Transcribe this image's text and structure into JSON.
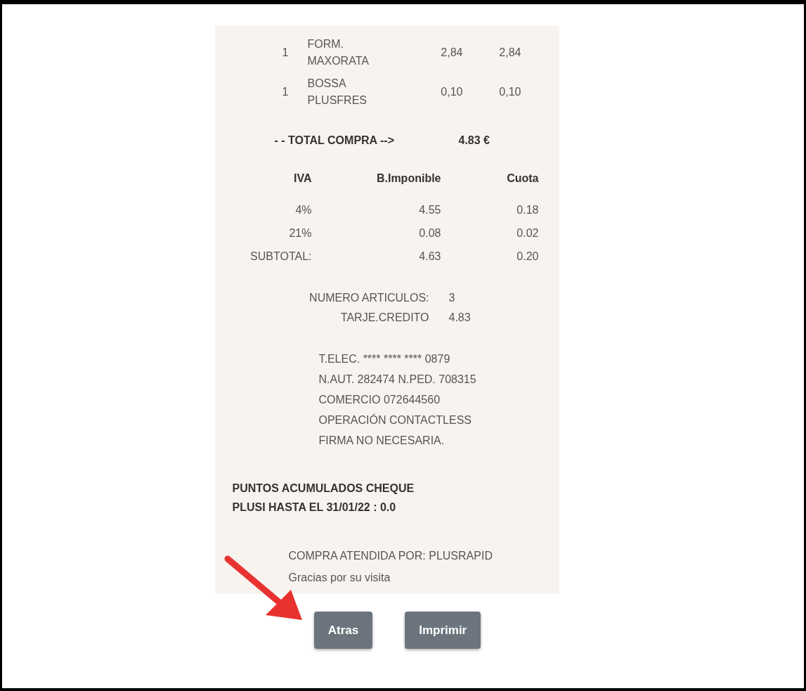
{
  "items": [
    {
      "qty": "1",
      "description": "FORM. MAXORATA",
      "price": "2,84",
      "amount": "2,84"
    },
    {
      "qty": "1",
      "description": "BOSSA PLUSFRES",
      "price": "0,10",
      "amount": "0,10"
    }
  ],
  "total": {
    "label": "- - TOTAL COMPRA -->",
    "value": "4.83 €"
  },
  "tax_table": {
    "columns": [
      "IVA",
      "B.Imponible",
      "Cuota"
    ],
    "rows": [
      [
        "4%",
        "4.55",
        "0.18"
      ],
      [
        "21%",
        "0.08",
        "0.02"
      ],
      [
        "SUBTOTAL:",
        "4.63",
        "0.20"
      ]
    ]
  },
  "summary": [
    {
      "label": "NUMERO ARTICULOS:",
      "value": "3"
    },
    {
      "label": "TARJE.CREDITO",
      "value": "4.83"
    }
  ],
  "card_lines": [
    "T.ELEC. **** **** **** 0879",
    "N.AUT. 282474 N.PED. 708315",
    "COMERCIO 072644560",
    "OPERACIÓN CONTACTLESS",
    "FIRMA NO NECESARIA."
  ],
  "points": "PUNTOS ACUMULADOS CHEQUE PLUSI HASTA EL 31/01/22 : 0.0",
  "footer": [
    "COMPRA ATENDIDA POR: PLUSRAPID",
    "Gracias por su visita"
  ],
  "buttons": [
    "Atras",
    "Imprimir"
  ]
}
